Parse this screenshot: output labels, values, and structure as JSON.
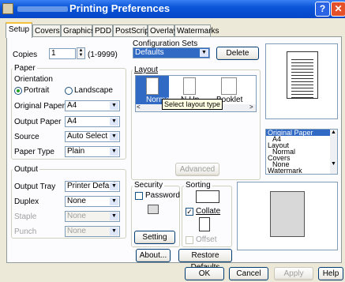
{
  "window": {
    "title": "Printing Preferences",
    "help_glyph": "?",
    "close_glyph": "✕"
  },
  "tabs": [
    {
      "label": "Setup",
      "active": true
    },
    {
      "label": "Covers"
    },
    {
      "label": "Graphics"
    },
    {
      "label": "PDD"
    },
    {
      "label": "PostScript"
    },
    {
      "label": "Overlay"
    },
    {
      "label": "Watermarks"
    }
  ],
  "copies": {
    "label": "Copies",
    "value": "1",
    "range": "(1-9999)"
  },
  "config": {
    "title": "Configuration Sets",
    "value": "Defaults",
    "delete_label": "Delete"
  },
  "paper": {
    "title": "Paper",
    "orientation_label": "Orientation",
    "portrait_label": "Portrait",
    "landscape_label": "Landscape",
    "original_paper_label": "Original Paper",
    "original_paper_value": "A4",
    "output_paper_label": "Output Paper",
    "output_paper_value": "A4",
    "source_label": "Source",
    "source_value": "Auto Select",
    "paper_type_label": "Paper Type",
    "paper_type_value": "Plain"
  },
  "layout": {
    "title": "Layout",
    "items": [
      "Normal",
      "N-Up",
      "Booklet"
    ],
    "tooltip": "Select layout type",
    "advanced_label": "Advanced"
  },
  "output": {
    "title": "Output",
    "tray_label": "Output Tray",
    "tray_value": "Printer Default",
    "duplex_label": "Duplex",
    "duplex_value": "None",
    "staple_label": "Staple",
    "staple_value": "None",
    "punch_label": "Punch",
    "punch_value": "None"
  },
  "security": {
    "title": "Security",
    "password_label": "Password",
    "setting_label": "Setting"
  },
  "sorting": {
    "title": "Sorting",
    "collate_label": "Collate",
    "offset_label": "Offset"
  },
  "summary": [
    "Original Paper",
    "A4",
    "Layout",
    "Normal",
    "Covers",
    "None",
    "Watermark"
  ],
  "buttons": {
    "about": "About...",
    "restore": "Restore Defaults",
    "ok": "OK",
    "cancel": "Cancel",
    "apply": "Apply",
    "help": "Help"
  }
}
